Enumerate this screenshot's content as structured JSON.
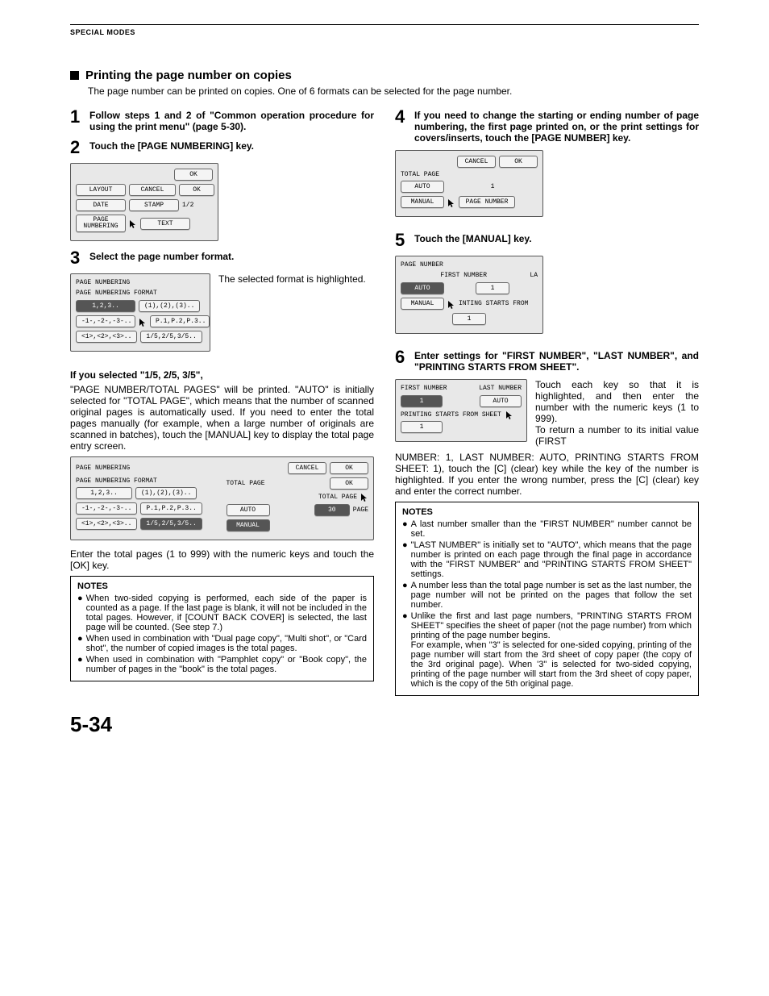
{
  "header": "SPECIAL MODES",
  "section": {
    "title": "Printing the page number on copies",
    "intro": "The page number can be printed on copies. One of 6 formats can be selected for the page number."
  },
  "steps": {
    "s1": {
      "num": "1",
      "text": "Follow steps 1 and 2 of \"Common operation procedure for using the print menu\" (page 5-30)."
    },
    "s2": {
      "num": "2",
      "text": "Touch the [PAGE NUMBERING] key."
    },
    "s3": {
      "num": "3",
      "text": "Select the page number format.",
      "side": "The selected format is highlighted."
    },
    "s4": {
      "num": "4",
      "text": "If you need to change the starting or ending number of page numbering, the first page printed on, or the print settings for covers/inserts, touch the [PAGE NUMBER] key."
    },
    "s5": {
      "num": "5",
      "text": "Touch the [MANUAL] key."
    },
    "s6": {
      "num": "6",
      "text": "Enter settings for \"FIRST NUMBER\", \"LAST NUMBER\", and \"PRINTING STARTS FROM SHEET\"."
    }
  },
  "panel2": {
    "ok": "OK",
    "layout": "LAYOUT",
    "cancel": "CANCEL",
    "ok2": "OK",
    "date": "DATE",
    "stamp": "STAMP",
    "frac": "1/2",
    "page_numbering": "PAGE\nNUMBERING",
    "textbtn": "TEXT"
  },
  "panel3a": {
    "title": "PAGE NUMBERING",
    "subtitle": "PAGE NUMBERING FORMAT",
    "opts": [
      "1,2,3..",
      "(1),(2),(3)..",
      "-1-,-2-,-3-..",
      "P.1,P.2,P.3..",
      "<1>,<2>,<3>..",
      "1/5,2/5,3/5.."
    ]
  },
  "selected_note": {
    "heading": "If you selected \"1/5, 2/5, 3/5\",",
    "para": "\"PAGE NUMBER/TOTAL PAGES\" will be printed. \"AUTO\" is initially selected for \"TOTAL PAGE\", which means that the number of scanned original pages is automatically used. If you need to enter the total pages manually (for example, when a large number of originals are scanned in batches), touch the [MANUAL] key to display the total page entry screen."
  },
  "panel3b": {
    "title": "PAGE NUMBERING",
    "subtitle": "PAGE NUMBERING FORMAT",
    "opts": [
      "1,2,3..",
      "(1),(2),(3)..",
      "-1-,-2-,-3-..",
      "P.1,P.2,P.3..",
      "<1>,<2>,<3>.."
    ],
    "opt_sel": "1/5,2/5,3/5..",
    "cancel": "CANCEL",
    "ok": "OK",
    "total_page": "TOTAL PAGE",
    "ok2": "OK",
    "tp_label": "TOTAL PAGE",
    "auto": "AUTO",
    "manual": "MANUAL",
    "thirty": "30",
    "page": "PAGE"
  },
  "after3b": "Enter the total pages (1 to 999) with the numeric keys and touch the [OK] key.",
  "notes_left": {
    "title": "NOTES",
    "items": [
      "When two-sided copying is performed, each side of the paper is counted as a page. If the last page is blank, it will not be included in the total pages. However, if [COUNT BACK COVER] is selected, the last page will be counted. (See step 7.)",
      "When used in combination with \"Dual page copy\", \"Multi shot\", or \"Card shot\", the number of copied images is the total pages.",
      "When used in combination with \"Pamphlet copy\" or \"Book copy\", the number of pages in the \"book\" is the total pages."
    ]
  },
  "panel4": {
    "cancel": "CANCEL",
    "ok": "OK",
    "total_page": "TOTAL PAGE",
    "auto": "AUTO",
    "one": "1",
    "manual": "MANUAL",
    "page_number": "PAGE NUMBER"
  },
  "panel5": {
    "title": "PAGE NUMBER",
    "first_number": "FIRST NUMBER",
    "la": "LA",
    "auto": "AUTO",
    "one": "1",
    "manual": "MANUAL",
    "starts": "INTING STARTS FROM",
    "one2": "1"
  },
  "panel6": {
    "first_number": "FIRST NUMBER",
    "last_number": "LAST NUMBER",
    "one": "1",
    "auto": "AUTO",
    "printing_starts": "PRINTING STARTS FROM SHEET",
    "one2": "1"
  },
  "step6_side": "Touch each key so that it is highlighted, and then enter the number with the numeric keys (1 to 999).\nTo return a number to its initial value (FIRST",
  "step6_after": "NUMBER: 1, LAST NUMBER: AUTO, PRINTING STARTS FROM SHEET: 1), touch the [C] (clear) key while the key of the number is highlighted. If you enter the wrong number, press the [C] (clear) key and enter the correct number.",
  "notes_right": {
    "title": "NOTES",
    "items": [
      "A last number smaller than the \"FIRST NUMBER\" number cannot be set.",
      "\"LAST NUMBER\" is initially set to \"AUTO\", which means that the page number is printed on each page through the final page in accordance with the \"FIRST NUMBER\" and \"PRINTING STARTS FROM SHEET\" settings.",
      "A number less than the total page number is set as the last number, the page number will not be printed on the pages that follow the set number.",
      "Unlike the first and last page numbers, \"PRINTING STARTS FROM SHEET\" specifies the sheet of paper (not the page number) from which printing of the page number begins.\nFor example, when \"3\" is selected for one-sided copying, printing of the page number will start from the 3rd sheet of copy paper (the copy of the 3rd original page). When '3\" is selected for two-sided copying, printing of the page number will start from the 3rd sheet of copy paper, which is the copy of the 5th original page."
    ]
  },
  "page_number": "5-34"
}
